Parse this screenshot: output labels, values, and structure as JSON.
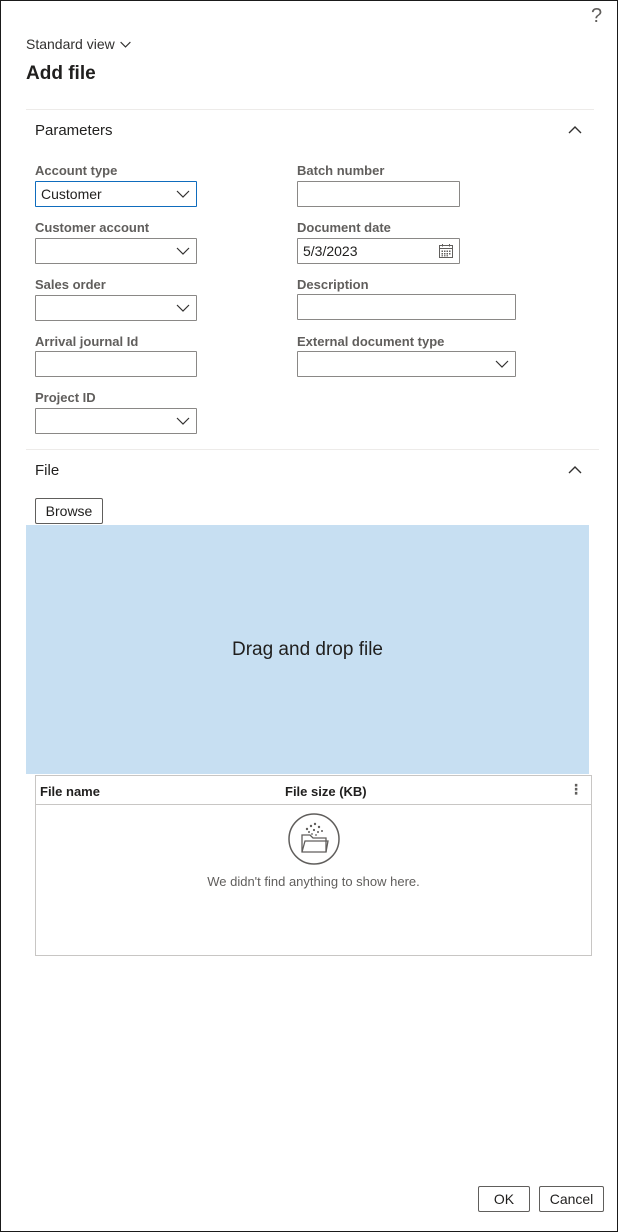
{
  "help": {
    "label": "?"
  },
  "header": {
    "view_label": "Standard view",
    "title": "Add file"
  },
  "parameters": {
    "title": "Parameters",
    "account_type": {
      "label": "Account type",
      "value": "Customer"
    },
    "batch_number": {
      "label": "Batch number",
      "value": ""
    },
    "customer_account": {
      "label": "Customer account",
      "value": ""
    },
    "document_date": {
      "label": "Document date",
      "value": "5/3/2023"
    },
    "sales_order": {
      "label": "Sales order",
      "value": ""
    },
    "description": {
      "label": "Description",
      "value": ""
    },
    "arrival_journal_id": {
      "label": "Arrival journal Id",
      "value": ""
    },
    "external_document_type": {
      "label": "External document type",
      "value": ""
    },
    "project_id": {
      "label": "Project ID",
      "value": ""
    }
  },
  "file": {
    "title": "File",
    "browse_label": "Browse",
    "dropzone_text": "Drag and drop file",
    "grid": {
      "columns": [
        "File name",
        "File size (KB)"
      ],
      "empty_text": "We didn't find anything to show here."
    }
  },
  "footer": {
    "ok_label": "OK",
    "cancel_label": "Cancel"
  },
  "colors": {
    "accent": "#0f6cbd",
    "dropzone": "#c7dff2",
    "border": "#8a8886"
  }
}
